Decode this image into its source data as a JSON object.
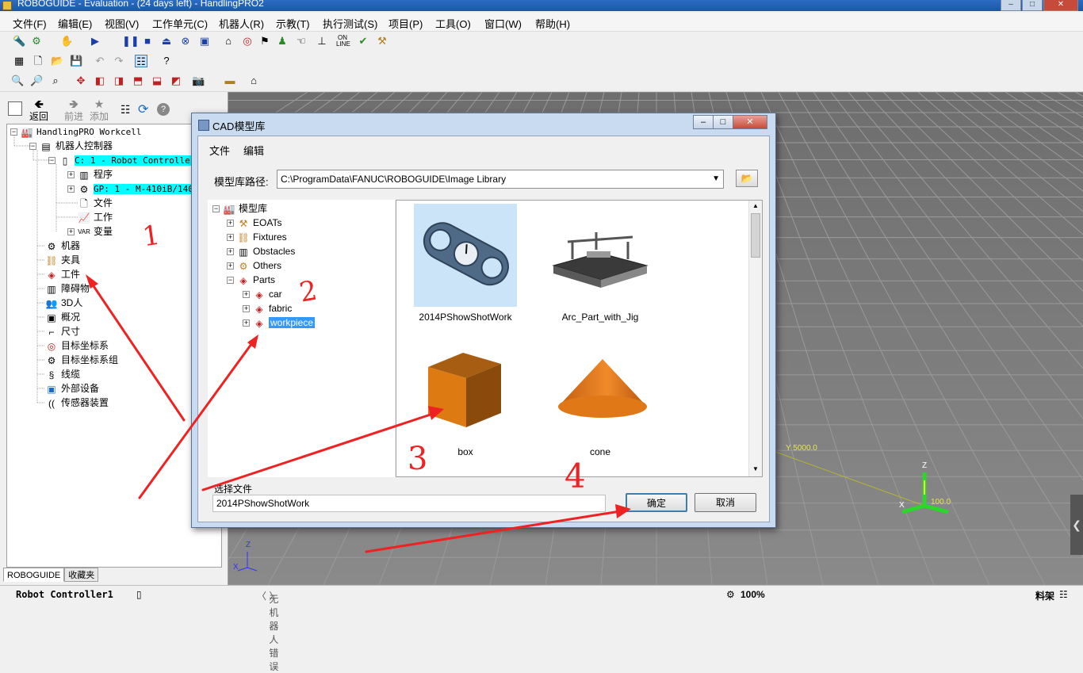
{
  "window": {
    "title": "ROBOGUIDE - Evaluation - (24 days left) - HandlingPRO2"
  },
  "menu": [
    "文件(F)",
    "编辑(E)",
    "视图(V)",
    "工作单元(C)",
    "机器人(R)",
    "示教(T)",
    "执行测试(S)",
    "项目(P)",
    "工具(O)",
    "窗口(W)",
    "帮助(H)"
  ],
  "nav": {
    "back": "返回",
    "forward": "前进",
    "add": "添加"
  },
  "tree": {
    "root": "HandlingPRO Workcell",
    "controller_group": "机器人控制器",
    "controller": "C: 1 - Robot Controller1",
    "program": "程序",
    "gp": "GP: 1 - M-410iB/140H",
    "file": "文件",
    "work": "工作",
    "variable": "变量",
    "machine": "机器",
    "fixture": "夹具",
    "part": "工件",
    "obstacle": "障碍物",
    "human": "3D人",
    "overview": "概况",
    "dimension": "尺寸",
    "target_frame": "目标坐标系",
    "target_frame_group": "目标坐标系组",
    "cable": "线缆",
    "external_device": "外部设备",
    "sensor": "传感器装置"
  },
  "tabs": [
    "ROBOGUIDE",
    "收藏夹"
  ],
  "dialog": {
    "title": "CAD模型库",
    "menu": [
      "文件",
      "编辑"
    ],
    "path_label": "模型库路径:",
    "path_value": "C:\\ProgramData\\FANUC\\ROBOGUIDE\\Image Library",
    "lib_tree": {
      "root": "模型库",
      "eoats": "EOATs",
      "fixtures": "Fixtures",
      "obstacles": "Obstacles",
      "others": "Others",
      "parts": "Parts",
      "car": "car",
      "fabric": "fabric",
      "workpiece": "workpiece"
    },
    "gallery": [
      "2014PShowShotWork",
      "Arc_Part_with_Jig",
      "box",
      "cone"
    ],
    "select_label": "选择文件",
    "select_value": "2014PShowShotWork",
    "ok": "确定",
    "cancel": "取消"
  },
  "viewport": {
    "y_label": "Y 5000.0",
    "z_label": "Z",
    "x_label": "X",
    "val": "100.0"
  },
  "annotations": [
    "1",
    "2",
    "3",
    "4"
  ],
  "status": {
    "controller": "Robot Controller1",
    "error": "无机器人错误",
    "zoom": "100%",
    "frame": "料架"
  }
}
